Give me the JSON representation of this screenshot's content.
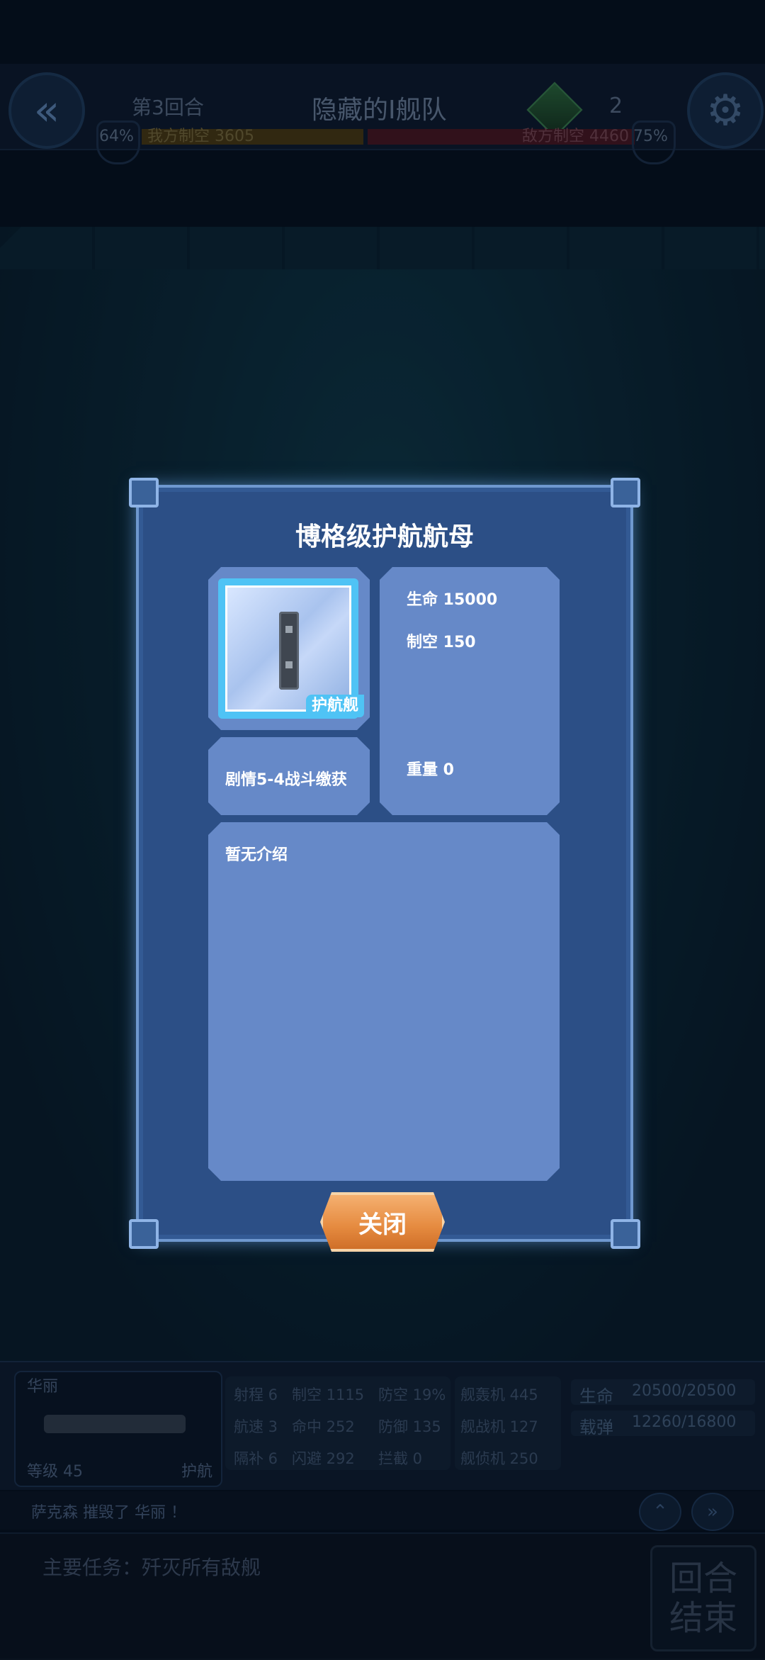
{
  "hud": {
    "round": "第3回合",
    "fleet_title": "隐藏的I舰队",
    "crate_count": "2",
    "ally_air": "我方制空 3605",
    "ally_pct": "64%",
    "enemy_air": "敌方制空 4460",
    "enemy_pct": "75%",
    "ally_air_share": 0.45,
    "enemy_air_share": 0.55
  },
  "unit": {
    "name": "华丽",
    "level": "等级 45",
    "class": "护航",
    "stats_col1": [
      "射程 6",
      "航速 3",
      "隔补 6"
    ],
    "stats_col2": [
      "制空 1115",
      "命中 252",
      "闪避 292"
    ],
    "stats_col3": [
      "防空 19%",
      "防御 135",
      "拦截 0"
    ],
    "planes": [
      "舰轰机 445",
      "舰战机 127",
      "舰侦机 250"
    ],
    "hp_label": "生命",
    "hp_value": "20500/20500",
    "ammo_label": "载弹",
    "ammo_value": "12260/16800"
  },
  "log": {
    "message": "萨克森 摧毁了 华丽 ！"
  },
  "mission": {
    "text": "主要任务：歼灭所有敌舰",
    "end_turn_line1": "回合",
    "end_turn_line2": "结束"
  },
  "modal": {
    "title": "博格级护航航母",
    "ship_tag": "护航舰",
    "hp": "生命 15000",
    "air": "制空 150",
    "weight": "重量 0",
    "source": "剧情5-4战斗缴获",
    "description": "暂无介绍",
    "close_label": "关闭"
  },
  "colors": {
    "modal_bg": "#2c4f86",
    "panel_bg": "#6689c8",
    "accent": "#4fc3f5",
    "close_button": "#e58a3f"
  }
}
